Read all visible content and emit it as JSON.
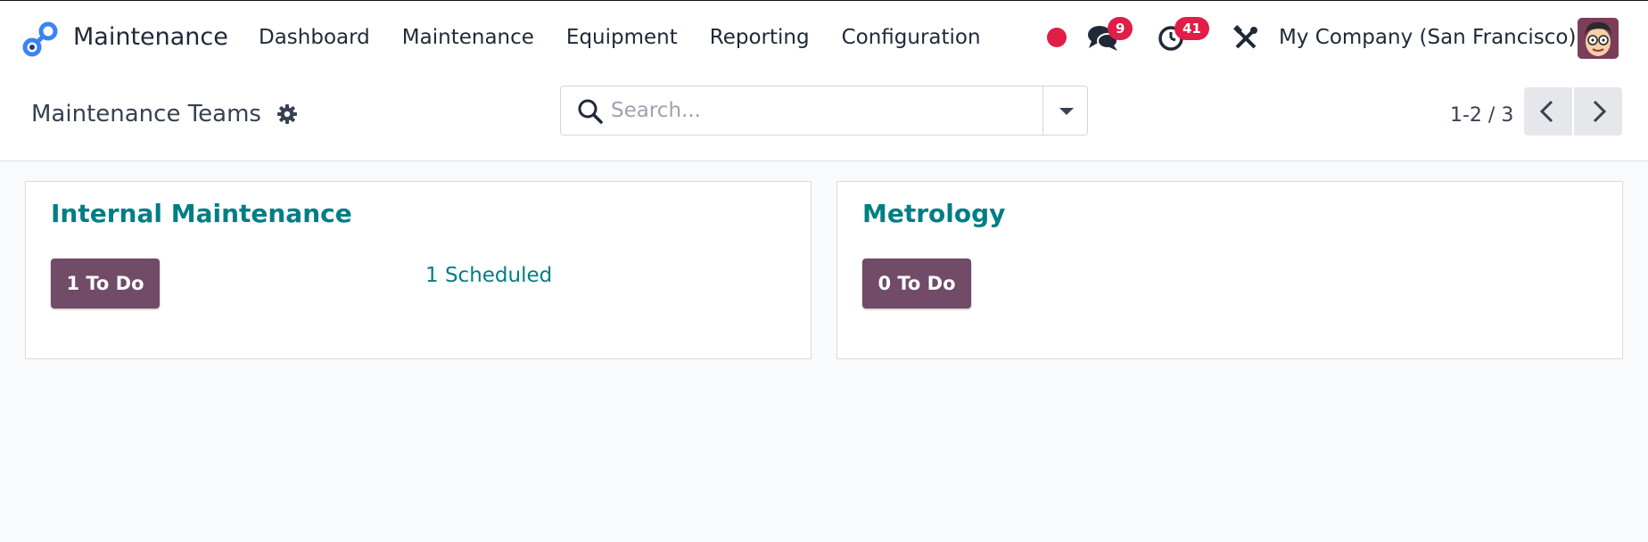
{
  "navbar": {
    "app_name": "Maintenance",
    "menu": [
      "Dashboard",
      "Maintenance",
      "Equipment",
      "Reporting",
      "Configuration"
    ],
    "messages_badge": "9",
    "activities_badge": "41",
    "company": "My Company (San Francisco)",
    "accent_color": "#e11d48"
  },
  "control_panel": {
    "title": "Maintenance Teams",
    "search_placeholder": "Search...",
    "pager": "1-2 / 3"
  },
  "teams": [
    {
      "name": "Internal Maintenance",
      "todo": "1 To Do",
      "scheduled": "1 Scheduled"
    },
    {
      "name": "Metrology",
      "todo": "0 To Do"
    }
  ],
  "colors": {
    "primary": "#714b67",
    "link": "#017e84"
  }
}
